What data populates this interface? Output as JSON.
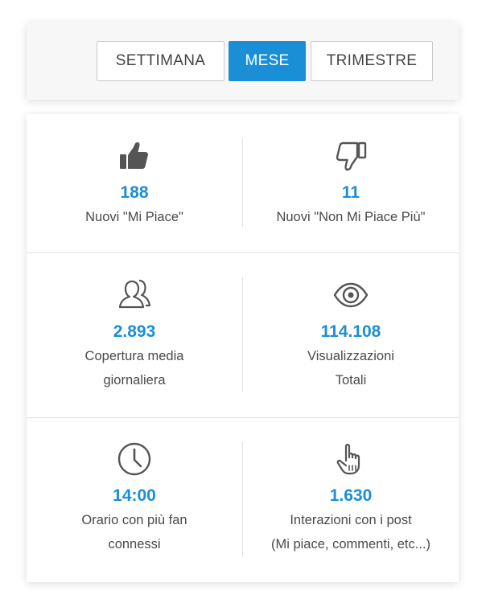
{
  "periods": {
    "week": "SETTIMANA",
    "month": "MESE",
    "quarter": "TRIMESTRE",
    "active": "month"
  },
  "stats": [
    {
      "icon": "thumbs-up-icon",
      "value": "188",
      "label": "Nuovi \"Mi Piace\""
    },
    {
      "icon": "thumbs-down-icon",
      "value": "11",
      "label": "Nuovi \"Non Mi Piace Più\""
    },
    {
      "icon": "users-icon",
      "value": "2.893",
      "label": "Copertura media\ngiornaliera"
    },
    {
      "icon": "eye-icon",
      "value": "114.108",
      "label": "Visualizzazioni\nTotali"
    },
    {
      "icon": "clock-icon",
      "value": "14:00",
      "label": "Orario con più fan\nconnessi"
    },
    {
      "icon": "pointer-hand-icon",
      "value": "1.630",
      "label": "Interazioni con i post\n(Mi piace, commenti, etc...)"
    }
  ],
  "colors": {
    "accent": "#1a8fd6",
    "icon": "#555555",
    "text": "#4a4a4a",
    "divider": "#e3e3e3"
  }
}
